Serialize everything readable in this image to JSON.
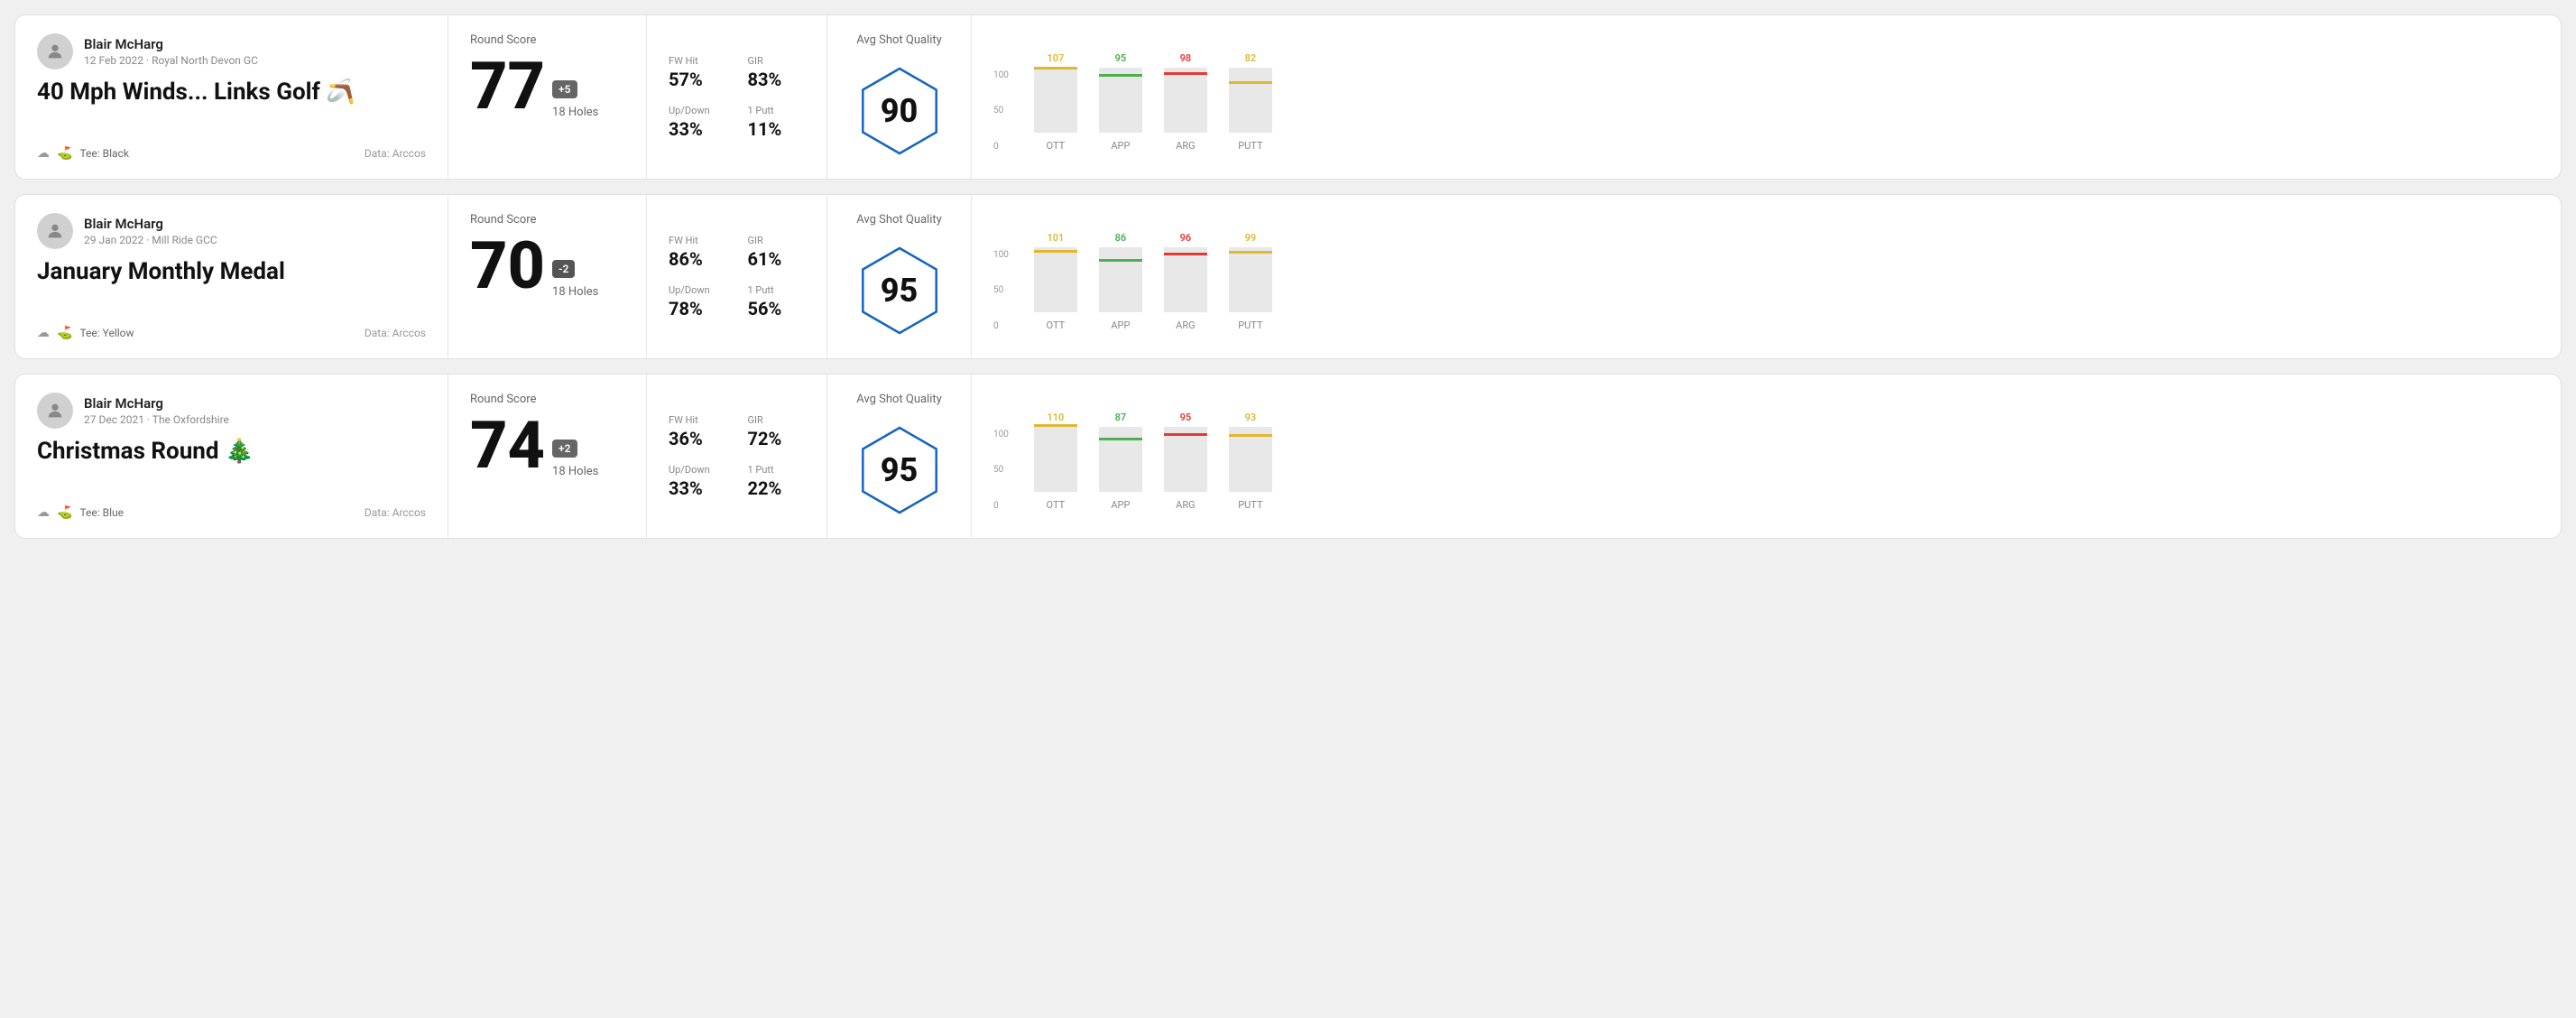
{
  "rounds": [
    {
      "player": "Blair McHarg",
      "date": "12 Feb 2022 · Royal North Devon GC",
      "title": "40 Mph Winds... Links Golf 🪃",
      "tee": "Tee: Black",
      "data_source": "Data: Arccos",
      "round_score_label": "Round Score",
      "score": "77",
      "score_diff": "+5",
      "holes": "18 Holes",
      "fw_hit_label": "FW Hit",
      "fw_hit": "57%",
      "gir_label": "GIR",
      "gir": "83%",
      "updown_label": "Up/Down",
      "updown": "33%",
      "oneputt_label": "1 Putt",
      "oneputt": "11%",
      "avg_shot_label": "Avg Shot Quality",
      "hex_score": "90",
      "bars": [
        {
          "label": "OTT",
          "value": 107,
          "color": "#e0b830",
          "height_pct": 72
        },
        {
          "label": "APP",
          "value": 95,
          "color": "#4caf50",
          "height_pct": 64
        },
        {
          "label": "ARG",
          "value": 98,
          "color": "#e53935",
          "height_pct": 66
        },
        {
          "label": "PUTT",
          "value": 82,
          "color": "#e0b830",
          "height_pct": 55
        }
      ]
    },
    {
      "player": "Blair McHarg",
      "date": "29 Jan 2022 · Mill Ride GCC",
      "title": "January Monthly Medal",
      "tee": "Tee: Yellow",
      "data_source": "Data: Arccos",
      "round_score_label": "Round Score",
      "score": "70",
      "score_diff": "-2",
      "holes": "18 Holes",
      "fw_hit_label": "FW Hit",
      "fw_hit": "86%",
      "gir_label": "GIR",
      "gir": "61%",
      "updown_label": "Up/Down",
      "updown": "78%",
      "oneputt_label": "1 Putt",
      "oneputt": "56%",
      "avg_shot_label": "Avg Shot Quality",
      "hex_score": "95",
      "bars": [
        {
          "label": "OTT",
          "value": 101,
          "color": "#e0b830",
          "height_pct": 68
        },
        {
          "label": "APP",
          "value": 86,
          "color": "#4caf50",
          "height_pct": 58
        },
        {
          "label": "ARG",
          "value": 96,
          "color": "#e53935",
          "height_pct": 65
        },
        {
          "label": "PUTT",
          "value": 99,
          "color": "#e0b830",
          "height_pct": 67
        }
      ]
    },
    {
      "player": "Blair McHarg",
      "date": "27 Dec 2021 · The Oxfordshire",
      "title": "Christmas Round 🎄",
      "tee": "Tee: Blue",
      "data_source": "Data: Arccos",
      "round_score_label": "Round Score",
      "score": "74",
      "score_diff": "+2",
      "holes": "18 Holes",
      "fw_hit_label": "FW Hit",
      "fw_hit": "36%",
      "gir_label": "GIR",
      "gir": "72%",
      "updown_label": "Up/Down",
      "updown": "33%",
      "oneputt_label": "1 Putt",
      "oneputt": "22%",
      "avg_shot_label": "Avg Shot Quality",
      "hex_score": "95",
      "bars": [
        {
          "label": "OTT",
          "value": 110,
          "color": "#e0b830",
          "height_pct": 74
        },
        {
          "label": "APP",
          "value": 87,
          "color": "#4caf50",
          "height_pct": 59
        },
        {
          "label": "ARG",
          "value": 95,
          "color": "#e53935",
          "height_pct": 64
        },
        {
          "label": "PUTT",
          "value": 93,
          "color": "#e0b830",
          "height_pct": 63
        }
      ]
    }
  ]
}
